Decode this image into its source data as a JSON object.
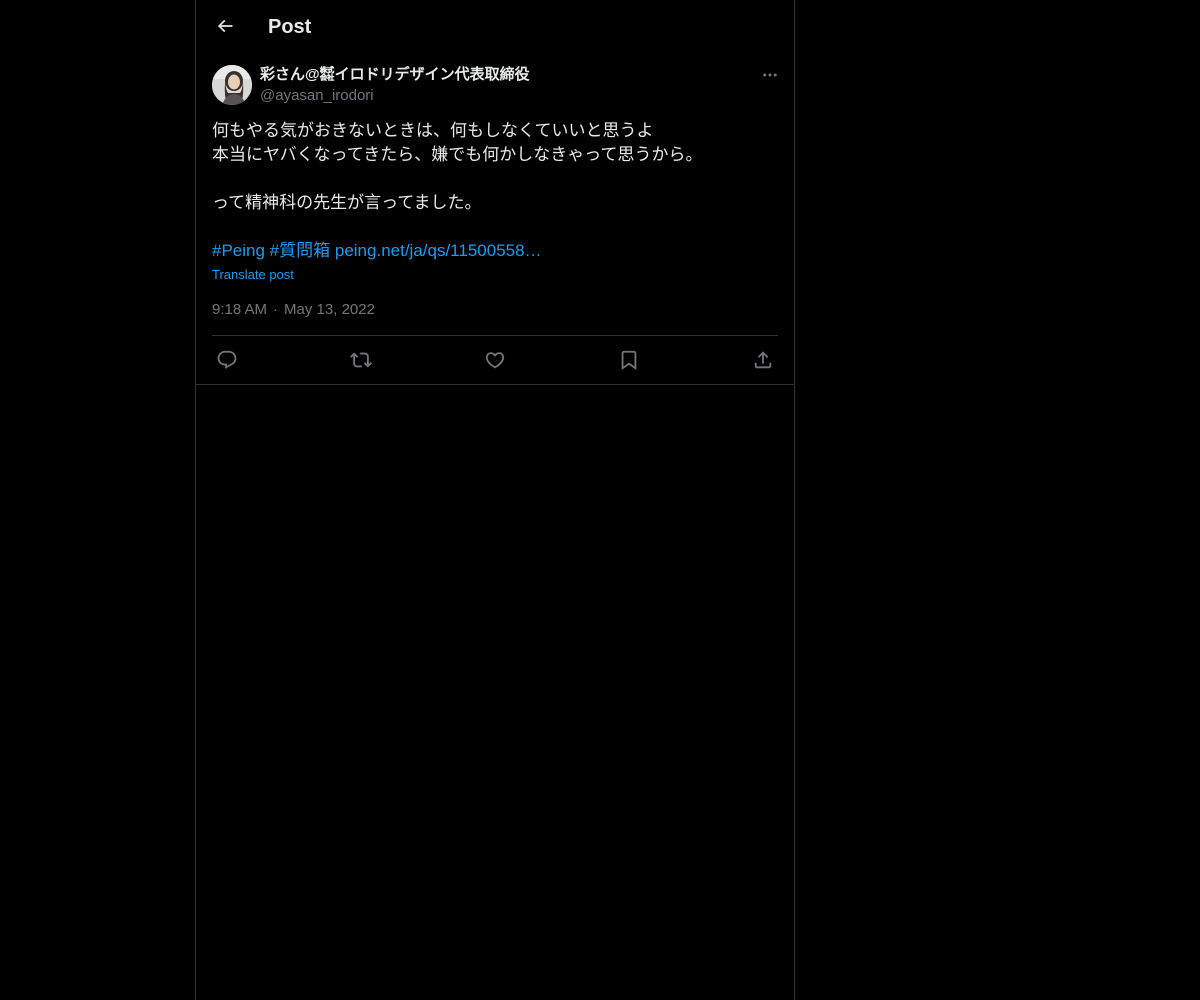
{
  "header": {
    "title": "Post"
  },
  "post": {
    "author_name": "彩さん@㍿イロドリデザイン代表取締役",
    "author_handle": "@ayasan_irodori",
    "text_lines": [
      "何もやる気がおきないときは、何もしなくていいと思うよ",
      "本当にヤバくなってきたら、嫌でも何かしなきゃって思うから。",
      "",
      "って精神科の先生が言ってました。"
    ],
    "hashtag_1": "#Peing",
    "hashtag_2": "#質問箱",
    "link": "peing.net/ja/qs/11500558…",
    "translate_label": "Translate post",
    "time": "9:18 AM",
    "separator": "·",
    "date": "May 13, 2022"
  },
  "icons": {
    "back": "arrow-left-icon",
    "more": "more-horizontal-icon",
    "reply": "reply-icon",
    "repost": "repost-icon",
    "like": "heart-icon",
    "bookmark": "bookmark-icon",
    "share": "share-icon"
  },
  "colors": {
    "background": "#000000",
    "text": "#e7e9ea",
    "muted": "#71767b",
    "link": "#1d9bf0",
    "border": "#2f3336"
  }
}
